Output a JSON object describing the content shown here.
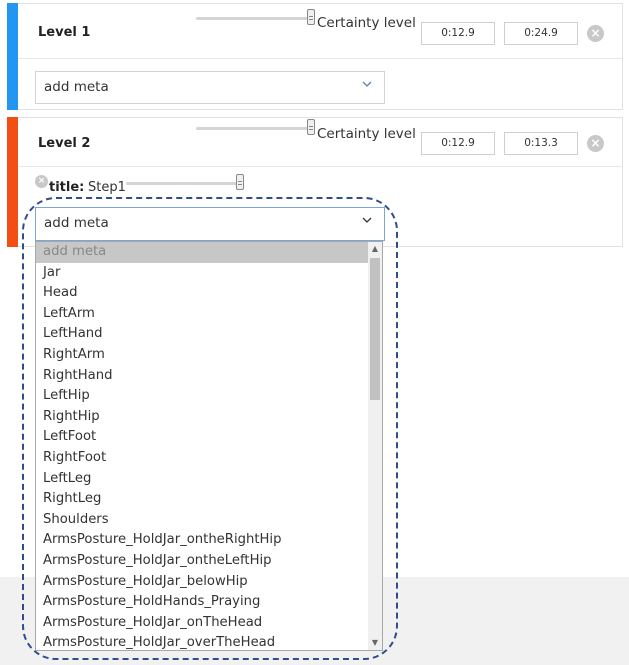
{
  "levels": [
    {
      "title": "Level 1",
      "bar_color": "#2196f3",
      "certainty_label": "Certainty level",
      "start_time": "0:12.9",
      "end_time": "0:24.9",
      "select_value": "add meta"
    },
    {
      "title": "Level 2",
      "bar_color": "#f44f12",
      "certainty_label": "Certainty level",
      "start_time": "0:12.9",
      "end_time": "0:13.3",
      "meta": {
        "key": "title:",
        "value": "Step1"
      },
      "select_value": "add meta"
    }
  ],
  "dropdown": {
    "selected": "add meta",
    "options": [
      "add meta",
      "Jar",
      "Head",
      "LeftArm",
      "LeftHand",
      "RightArm",
      "RightHand",
      "LeftHip",
      "RightHip",
      "LeftFoot",
      "RightFoot",
      "LeftLeg",
      "RightLeg",
      "Shoulders",
      "ArmsPosture_HoldJar_ontheRightHip",
      "ArmsPosture_HoldJar_ontheLeftHip",
      "ArmsPosture_HoldJar_belowHip",
      "ArmsPosture_HoldHands_Praying",
      "ArmsPosture_HoldJar_onTheHead",
      "ArmsPosture_HoldJar_overTheHead"
    ]
  },
  "icons": {
    "remove": "×",
    "scroll_up": "▲",
    "scroll_down": "▼"
  },
  "colors": {
    "highlight": "#2e4d8b"
  }
}
